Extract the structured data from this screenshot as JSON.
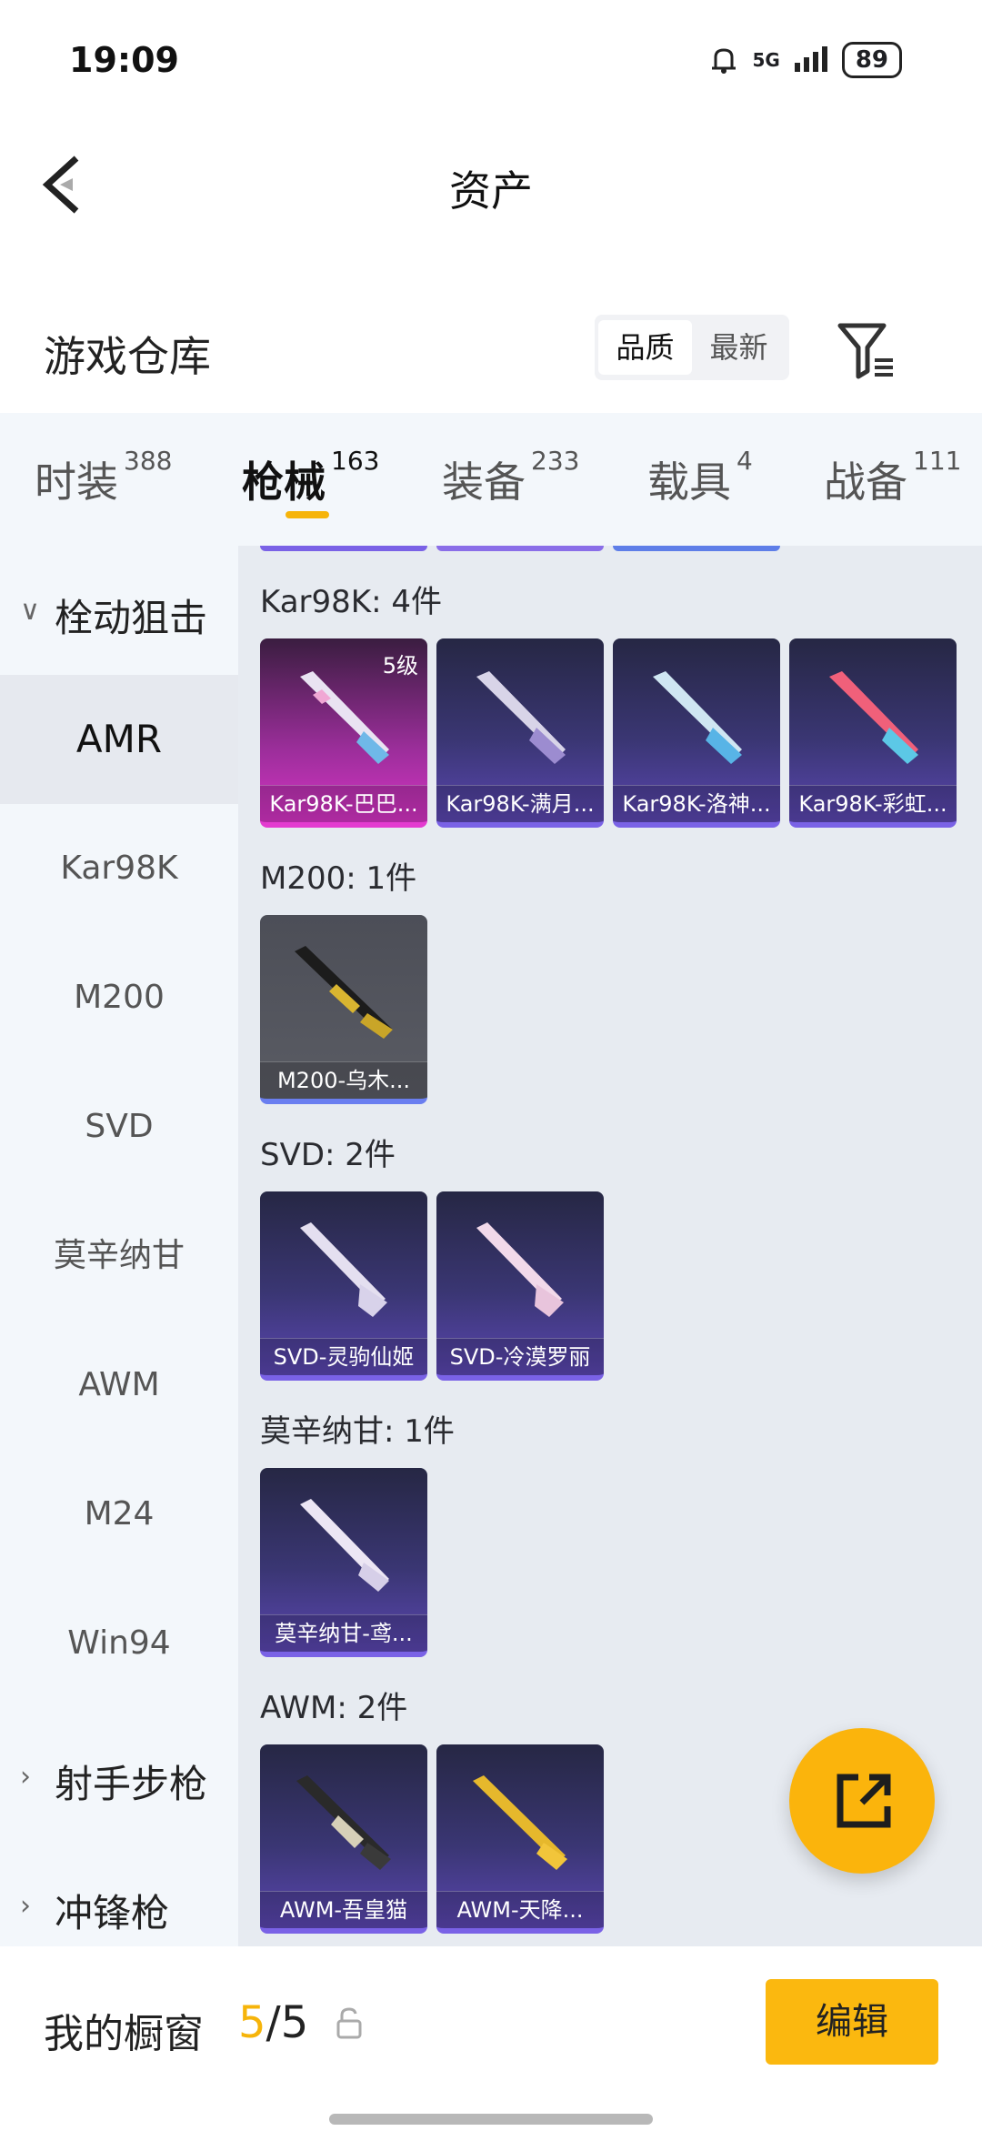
{
  "status_bar": {
    "time": "19:09",
    "network": "5G",
    "battery": "89"
  },
  "header": {
    "title": "资产"
  },
  "warehouse": {
    "title": "游戏仓库",
    "sort_options": [
      "品质",
      "最新"
    ],
    "active_sort": "品质"
  },
  "tabs": [
    {
      "label": "时装",
      "count": "388"
    },
    {
      "label": "枪械",
      "count": "163",
      "active": true
    },
    {
      "label": "装备",
      "count": "233"
    },
    {
      "label": "载具",
      "count": "4"
    },
    {
      "label": "战备",
      "count": "111"
    }
  ],
  "sidebar": {
    "groups": [
      {
        "label": "栓动狙击",
        "expanded": true
      },
      {
        "label": "射手步枪",
        "expanded": false
      },
      {
        "label": "冲锋枪",
        "expanded": false
      }
    ],
    "items": [
      "AMR",
      "Kar98K",
      "M200",
      "SVD",
      "莫辛纳甘",
      "AWM",
      "M24",
      "Win94"
    ],
    "active_item": "AMR"
  },
  "weapon_groups": [
    {
      "title": "Kar98K: 4件",
      "items": [
        {
          "name": "Kar98K-巴巴...",
          "level": "5级",
          "rarity": "pink"
        },
        {
          "name": "Kar98K-满月...",
          "rarity": "purple"
        },
        {
          "name": "Kar98K-洛神...",
          "rarity": "purple"
        },
        {
          "name": "Kar98K-彩虹...",
          "rarity": "purple"
        }
      ]
    },
    {
      "title": "M200: 1件",
      "items": [
        {
          "name": "M200-乌木...",
          "rarity": "gray"
        }
      ]
    },
    {
      "title": "SVD: 2件",
      "items": [
        {
          "name": "SVD-灵驹仙姬",
          "rarity": "purple"
        },
        {
          "name": "SVD-冷漠罗丽",
          "rarity": "purple"
        }
      ]
    },
    {
      "title": "莫辛纳甘: 1件",
      "items": [
        {
          "name": "莫辛纳甘-鸢...",
          "rarity": "purple"
        }
      ]
    },
    {
      "title": "AWM: 2件",
      "items": [
        {
          "name": "AWM-吾皇猫",
          "rarity": "purple"
        },
        {
          "name": "AWM-天降...",
          "rarity": "purple"
        }
      ]
    }
  ],
  "showcase": {
    "label": "我的橱窗",
    "current": "5",
    "separator": "/",
    "total": "5"
  },
  "edit_button": "编辑",
  "colors": {
    "accent": "#f6b40a",
    "purple_rarity": "#7a62e6",
    "pink_rarity": "#e43bd0"
  }
}
